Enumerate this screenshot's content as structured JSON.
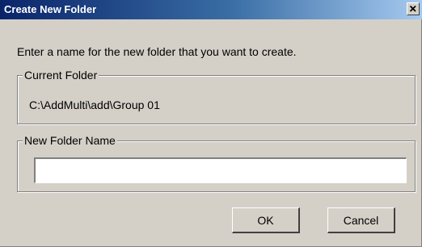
{
  "window": {
    "title": "Create New Folder",
    "close_icon": "close-icon"
  },
  "prompt": "Enter a name for the new folder that you want to create.",
  "current_folder": {
    "legend": "Current Folder",
    "path": "C:\\AddMulti\\add\\Group 01"
  },
  "new_folder": {
    "legend": "New Folder Name",
    "value": "",
    "placeholder": ""
  },
  "buttons": {
    "ok_label": "OK",
    "cancel_label": "Cancel"
  },
  "colors": {
    "dialog_face": "#d4d0c8",
    "titlebar_start": "#0a246a",
    "titlebar_end": "#a6caf0",
    "title_text": "#ffffff"
  }
}
